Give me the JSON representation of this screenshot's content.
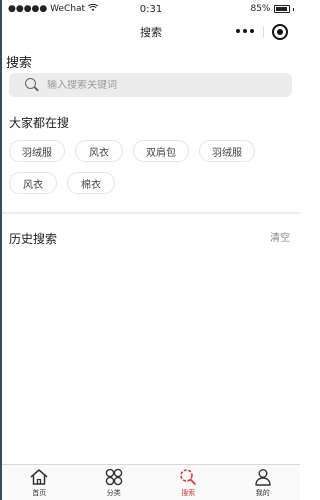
{
  "status_bar": {
    "carrier": "●●●●● WeChat",
    "time": "0:31",
    "battery": "85%"
  },
  "nav": {
    "title": "搜索",
    "menu_icon": "more-dots-icon",
    "capsule_icon": "target-icon"
  },
  "search": {
    "section_title": "搜索",
    "placeholder": "输入搜索关键词",
    "value": ""
  },
  "hot": {
    "title": "大家都在搜",
    "tags": [
      "羽绒服",
      "风衣",
      "双肩包",
      "羽绒服",
      "风衣",
      "棉衣"
    ]
  },
  "history": {
    "title": "历史搜索",
    "clear_label": "清空"
  },
  "tabbar": {
    "active_color": "#d93c37",
    "items": [
      {
        "label": "首页",
        "icon": "home-icon"
      },
      {
        "label": "分类",
        "icon": "category-icon"
      },
      {
        "label": "搜索",
        "icon": "search-icon"
      },
      {
        "label": "我的",
        "icon": "user-icon"
      }
    ]
  }
}
